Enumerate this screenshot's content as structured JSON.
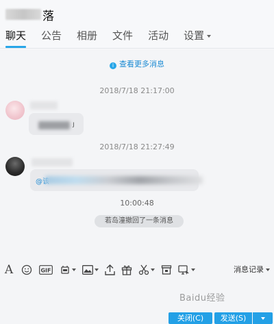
{
  "header": {
    "title_suffix": "落",
    "tabs": [
      {
        "label": "聊天",
        "active": true
      },
      {
        "label": "公告"
      },
      {
        "label": "相册"
      },
      {
        "label": "文件"
      },
      {
        "label": "活动"
      },
      {
        "label": "设置"
      }
    ]
  },
  "chat": {
    "more_link": "查看更多消息",
    "messages": [
      {
        "timestamp": "2018/7/18 21:17:00",
        "bubble_mark": "ȷ"
      },
      {
        "timestamp": "2018/7/18 21:27:49",
        "mention_prefix": "@该"
      }
    ],
    "recall_time": "10:00:48",
    "recall_notice": "若岛潼撤回了一条消息"
  },
  "toolbar": {
    "font_icon_text": "A",
    "gif_label": "GIF",
    "history_label": "消息记录"
  },
  "watermark": "Baidu经验",
  "footer": {
    "close_label": "关闭(C)",
    "send_label": "发送(S)"
  },
  "colors": {
    "accent": "#23a0e6",
    "tab_underline": "#27a6e8",
    "link": "#1b8ad3"
  }
}
